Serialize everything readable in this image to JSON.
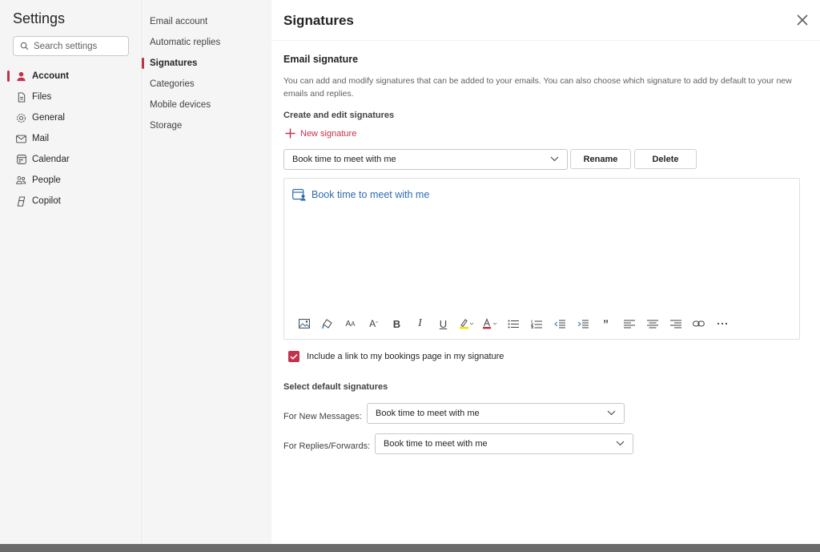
{
  "settings": {
    "title": "Settings",
    "search_placeholder": "Search settings",
    "nav": [
      {
        "label": "Account",
        "icon": "person-icon",
        "active": true
      },
      {
        "label": "Files",
        "icon": "file-icon"
      },
      {
        "label": "General",
        "icon": "gear-icon"
      },
      {
        "label": "Mail",
        "icon": "mail-icon"
      },
      {
        "label": "Calendar",
        "icon": "calendar-icon"
      },
      {
        "label": "People",
        "icon": "people-icon"
      },
      {
        "label": "Copilot",
        "icon": "copilot-icon"
      }
    ]
  },
  "subnav": [
    {
      "label": "Email account"
    },
    {
      "label": "Automatic replies"
    },
    {
      "label": "Signatures",
      "active": true
    },
    {
      "label": "Categories"
    },
    {
      "label": "Mobile devices"
    },
    {
      "label": "Storage"
    }
  ],
  "main": {
    "title": "Signatures",
    "section_title": "Email signature",
    "description": "You can add and modify signatures that can be added to your emails. You can also choose which signature to add by default to your new emails and replies.",
    "create_label": "Create and edit signatures",
    "new_signature_label": "New signature",
    "selected_signature": "Book time to meet with me",
    "rename_label": "Rename",
    "delete_label": "Delete",
    "editor_text": "Book time to meet with me",
    "checkbox_label": "Include a link to my bookings page in my signature",
    "checkbox_checked": true,
    "default_label": "Select default signatures",
    "new_messages_label": "For New Messages:",
    "new_messages_value": "Book time to meet with me",
    "replies_label": "For Replies/Forwards:",
    "replies_value": "Book time to meet with me"
  },
  "toolbar_icons": [
    "insert-picture-icon",
    "format-painter-icon",
    "font-size-icon",
    "superscript-icon",
    "bold-icon",
    "italic-icon",
    "underline-icon",
    "highlight-icon",
    "font-color-icon",
    "bullets-icon",
    "numbering-icon",
    "decrease-indent-icon",
    "increase-indent-icon",
    "quote-icon",
    "align-left-icon",
    "align-center-icon",
    "align-right-icon",
    "link-icon",
    "more-options-icon"
  ],
  "colors": {
    "accent": "#c4314b",
    "link": "#2f6cb0",
    "panel": "#f5f5f5"
  }
}
